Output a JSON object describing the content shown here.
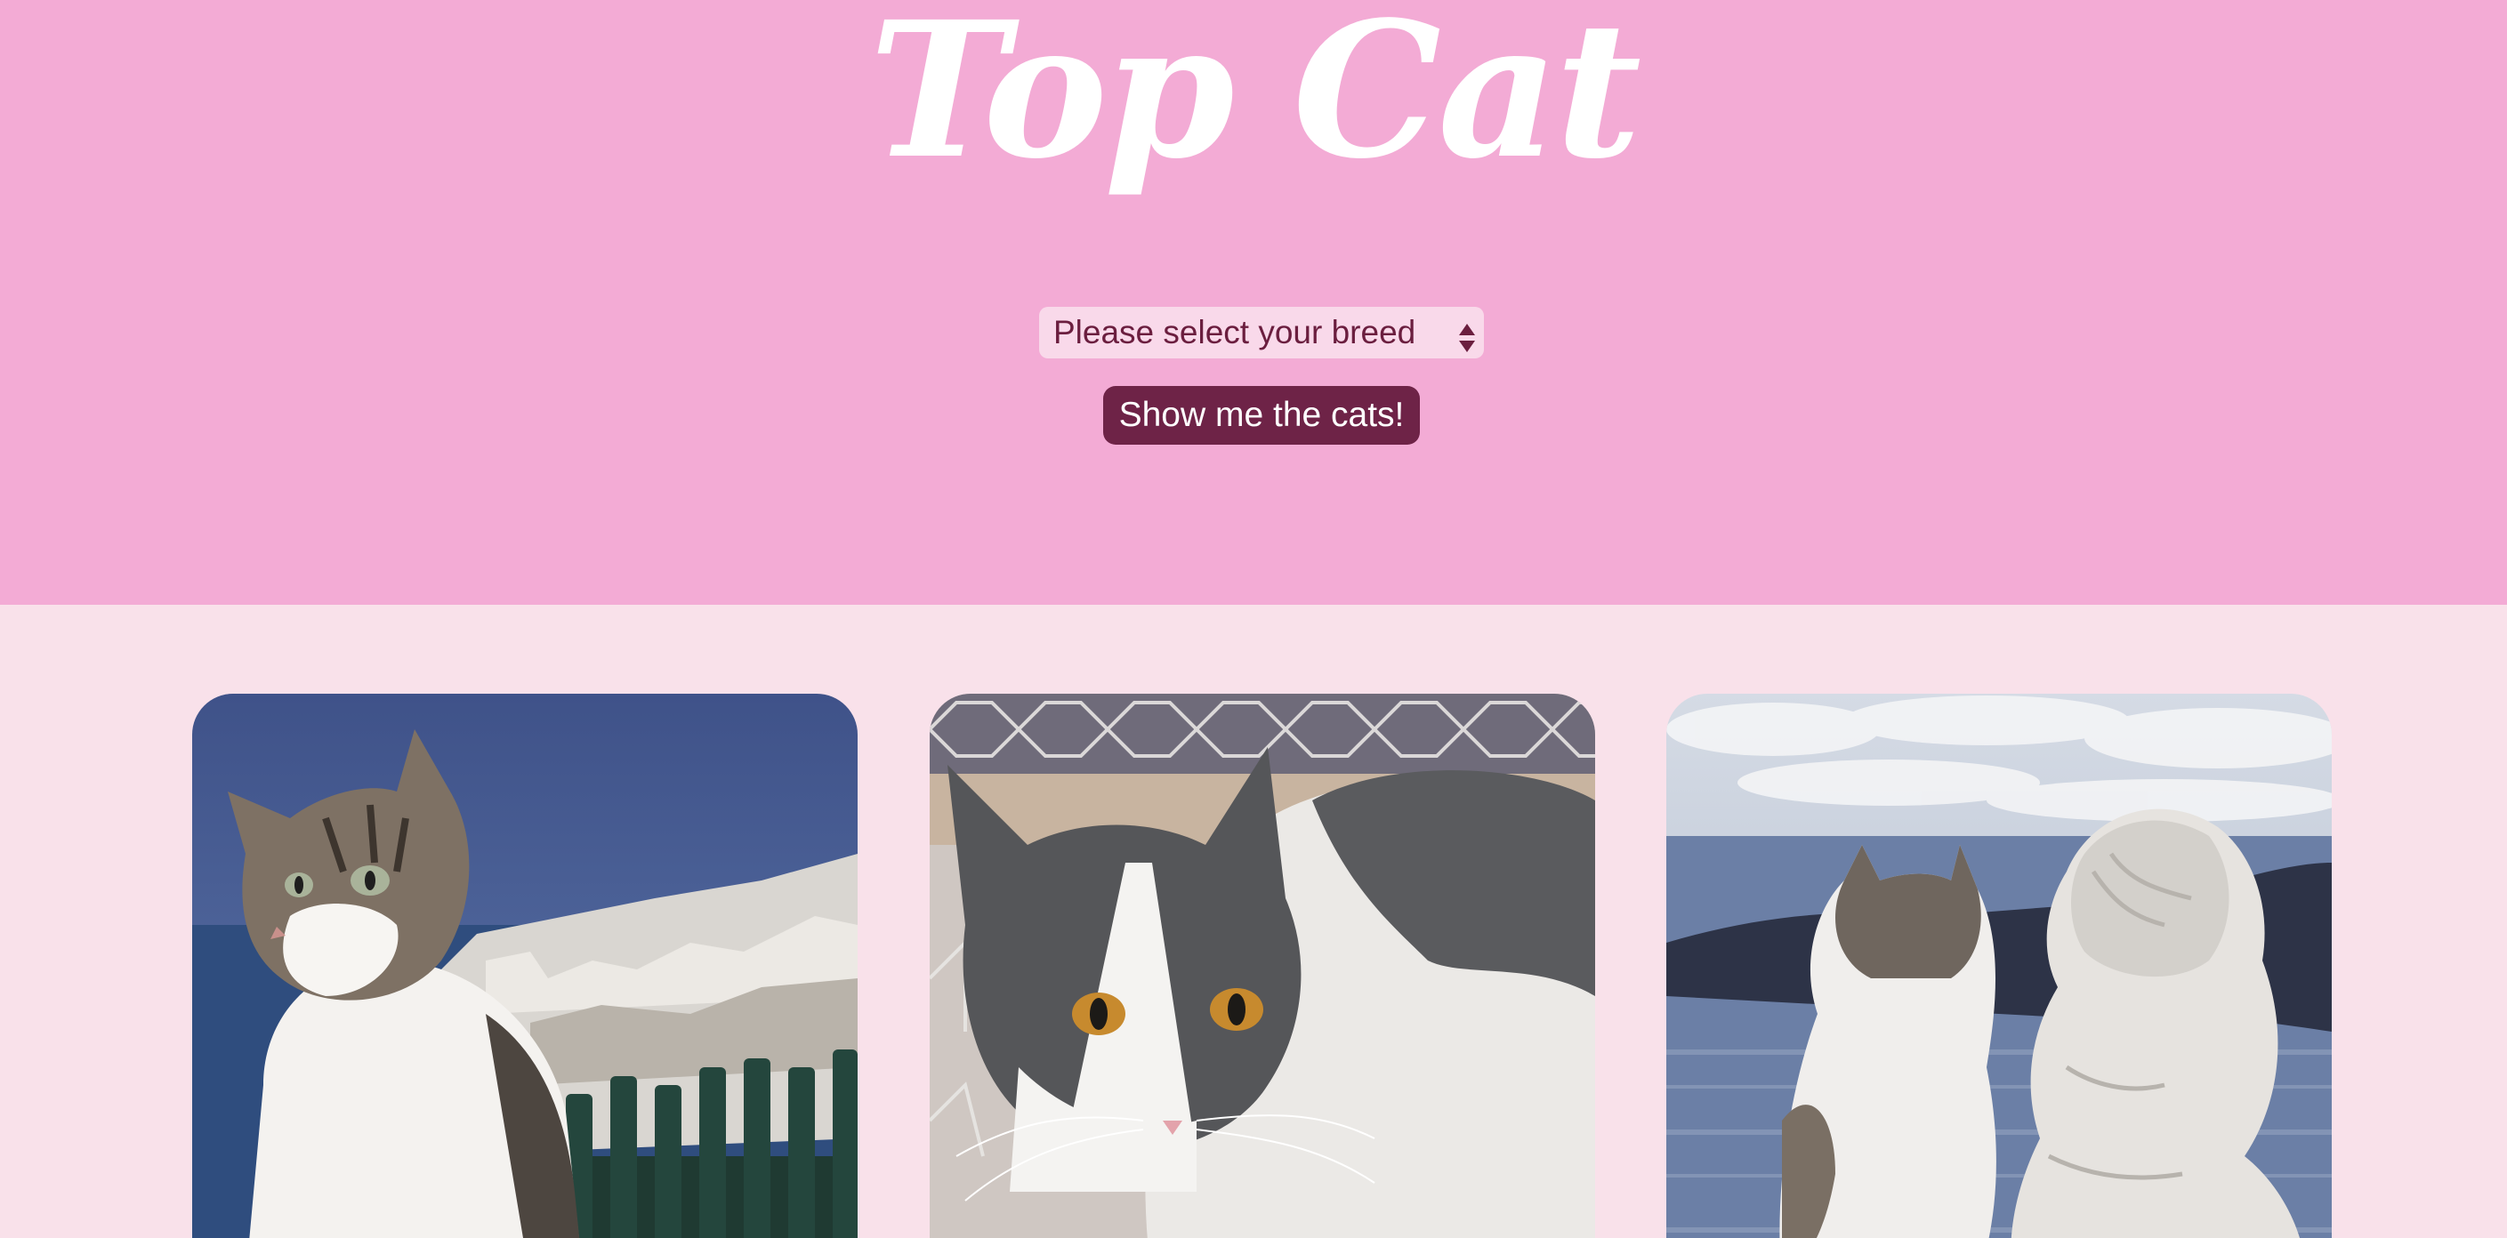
{
  "header": {
    "title": "Top Cat",
    "breed_select": {
      "selected_label": "Please select your breed"
    },
    "show_button_label": "Show me the cats!"
  },
  "gallery": {
    "cards": [
      {
        "icon": "cat-photo-icon"
      },
      {
        "icon": "cat-photo-icon"
      },
      {
        "icon": "cat-photo-icon"
      }
    ]
  },
  "colors": {
    "hero_background": "#f3abd5",
    "page_background": "#f9e1ea",
    "button_background": "#6e2347",
    "select_background": "#f9d9ea",
    "title_color": "#ffffff"
  }
}
